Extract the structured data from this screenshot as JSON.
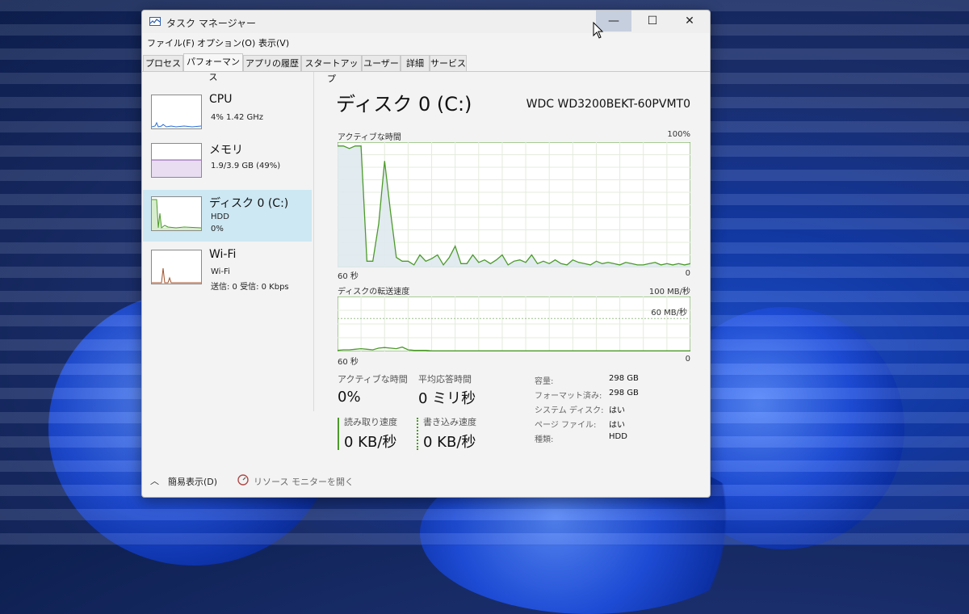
{
  "window": {
    "title": "タスク マネージャー",
    "min_glyph": "—",
    "max_glyph": "☐",
    "close_glyph": "✕"
  },
  "menu": [
    "ファイル(F)",
    "オプション(O)",
    "表示(V)"
  ],
  "tabs": [
    "プロセス",
    "パフォーマンス",
    "アプリの履歴",
    "スタートアップ",
    "ユーザー",
    "詳細",
    "サービス"
  ],
  "active_tab": "パフォーマンス",
  "sidebar": {
    "items": [
      {
        "title": "CPU",
        "lines": [
          "4%  1.42 GHz"
        ],
        "color": "#2a6fd6"
      },
      {
        "title": "メモリ",
        "lines": [
          "1.9/3.9 GB (49%)"
        ],
        "color": "#8a4fb0"
      },
      {
        "title": "ディスク 0 (C:)",
        "lines": [
          "HDD",
          "0%"
        ],
        "color": "#4c9a2a",
        "selected": true
      },
      {
        "title": "Wi-Fi",
        "lines": [
          "Wi-Fi",
          "送信: 0 受信: 0 Kbps"
        ],
        "color": "#a0522d"
      }
    ]
  },
  "main": {
    "title": "ディスク 0 (C:)",
    "model": "WDC WD3200BEKT-60PVMT0",
    "chart1": {
      "label": "アクティブな時間",
      "max_label": "100%",
      "x_left": "60 秒",
      "x_right": "0"
    },
    "chart2": {
      "label": "ディスクの転送速度",
      "max_label": "100 MB/秒",
      "inner_label": "60 MB/秒",
      "x_left": "60 秒",
      "x_right": "0"
    },
    "stats": {
      "active_label": "アクティブな時間",
      "active_value": "0%",
      "response_label": "平均応答時間",
      "response_value": "0 ミリ秒",
      "read_label": "読み取り速度",
      "read_value": "0 KB/秒",
      "write_label": "書き込み速度",
      "write_value": "0 KB/秒"
    },
    "details": [
      {
        "label": "容量:",
        "value": "298 GB"
      },
      {
        "label": "フォーマット済み:",
        "value": "298 GB"
      },
      {
        "label": "システム ディスク:",
        "value": "はい"
      },
      {
        "label": "ページ ファイル:",
        "value": "はい"
      },
      {
        "label": "種類:",
        "value": "HDD"
      }
    ]
  },
  "footer": {
    "simple_view": "簡易表示(D)",
    "resource_monitor": "リソース モニターを開く"
  },
  "chart_data": [
    {
      "type": "area",
      "title": "アクティブな時間",
      "ylim": [
        0,
        100
      ],
      "x_range": [
        60,
        0
      ],
      "values": [
        97,
        97,
        95,
        97,
        97,
        5,
        5,
        35,
        85,
        45,
        8,
        5,
        5,
        2,
        10,
        5,
        7,
        10,
        2,
        8,
        17,
        3,
        3,
        10,
        4,
        6,
        3,
        6,
        10,
        2,
        5,
        6,
        4,
        10,
        3,
        5,
        3,
        6,
        3,
        2,
        6,
        4,
        3,
        2,
        5,
        3,
        4,
        3,
        2,
        4,
        3,
        2,
        2,
        3,
        4,
        2,
        3,
        2,
        3,
        2,
        3
      ]
    },
    {
      "type": "line",
      "title": "ディスクの転送速度",
      "ylim": [
        0,
        100
      ],
      "x_range": [
        60,
        0
      ],
      "values": [
        2,
        3,
        3,
        4,
        5,
        4,
        3,
        6,
        7,
        6,
        5,
        8,
        3,
        2,
        2,
        2,
        1,
        1,
        1,
        1,
        1,
        1,
        1,
        1,
        1,
        1,
        1,
        1,
        1,
        1,
        1,
        1,
        1,
        1,
        1,
        1,
        1,
        1,
        1,
        1,
        1,
        1,
        1,
        1,
        1,
        1,
        1,
        1,
        1,
        1,
        1,
        1,
        1,
        1,
        1,
        1,
        1,
        1,
        1,
        1,
        1
      ]
    }
  ]
}
